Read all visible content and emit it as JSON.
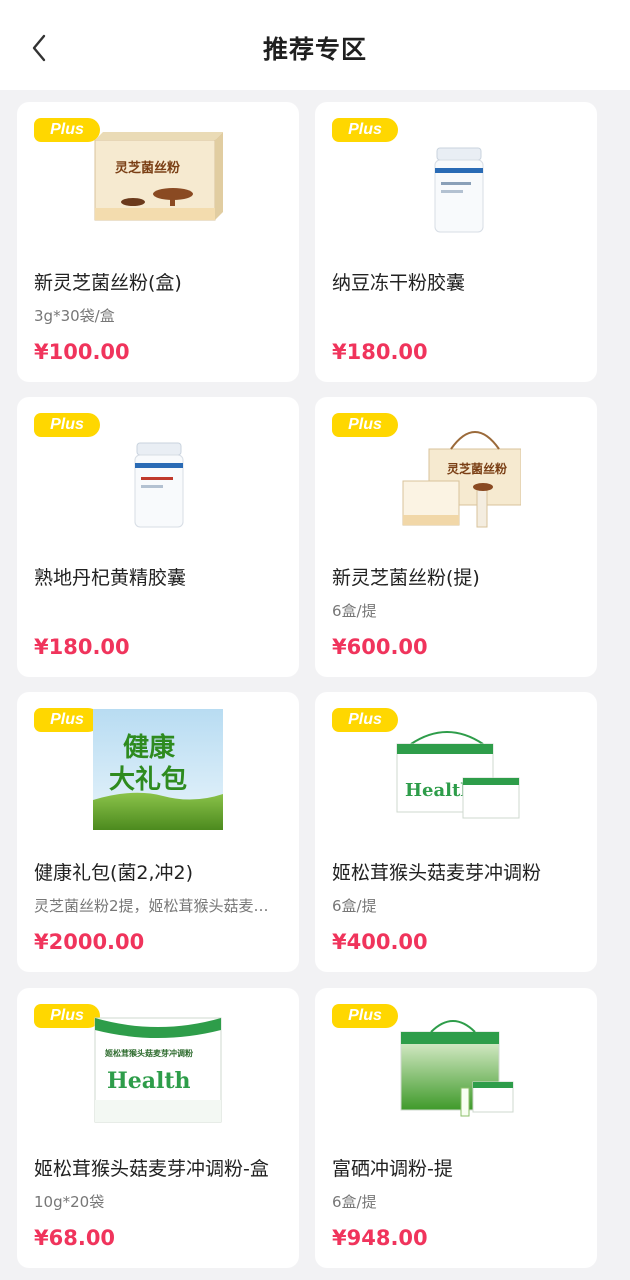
{
  "header": {
    "title": "推荐专区",
    "back_icon": "chevron-left-icon"
  },
  "colors": {
    "accent_price": "#f0345c",
    "badge": "#ffd700",
    "background": "#f2f2f4"
  },
  "products": [
    {
      "badge": "Plus",
      "name": "新灵芝菌丝粉(盒)",
      "spec": "3g*30袋/盒",
      "price": "¥100.00",
      "image_text": [
        "灵芝菌丝粉"
      ]
    },
    {
      "badge": "Plus",
      "name": "纳豆冻干粉胶囊",
      "spec": "",
      "price": "¥180.00",
      "image_text": []
    },
    {
      "badge": "Plus",
      "name": "熟地丹杞黄精胶囊",
      "spec": "",
      "price": "¥180.00",
      "image_text": []
    },
    {
      "badge": "Plus",
      "name": "新灵芝菌丝粉(提)",
      "spec": "6盒/提",
      "price": "¥600.00",
      "image_text": [
        "灵芝菌丝粉"
      ]
    },
    {
      "badge": "Plus",
      "name": "健康礼包(菌2,冲2)",
      "spec": "灵芝菌丝粉2提，姬松茸猴头菇麦…",
      "price": "¥2000.00",
      "image_text": [
        "健康",
        "大礼包"
      ]
    },
    {
      "badge": "Plus",
      "name": "姬松茸猴头菇麦芽冲调粉",
      "spec": "6盒/提",
      "price": "¥400.00",
      "image_text": [
        "Health"
      ]
    },
    {
      "badge": "Plus",
      "name": "姬松茸猴头菇麦芽冲调粉-盒",
      "spec": "10g*20袋",
      "price": "¥68.00",
      "image_text": [
        "姬松茸猴头菇麦芽冲调粉",
        "Health"
      ]
    },
    {
      "badge": "Plus",
      "name": "富硒冲调粉-提",
      "spec": "6盒/提",
      "price": "¥948.00",
      "image_text": []
    }
  ]
}
